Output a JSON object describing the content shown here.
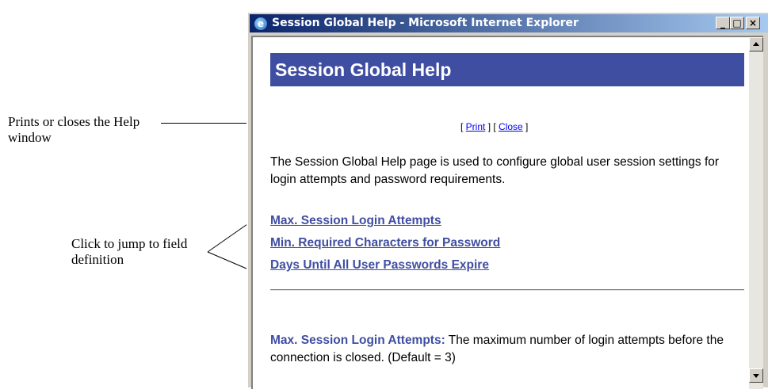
{
  "callouts": {
    "print_close": "Prints or closes the Help window",
    "field_jump": "Click to jump to field definition"
  },
  "window": {
    "title": "Session Global Help - Microsoft Internet Explorer",
    "icon": "ie-icon",
    "controls": {
      "minimize": "_",
      "maximize": "□",
      "close": "×"
    }
  },
  "page": {
    "heading": "Session Global Help",
    "toolbar": {
      "open1": "[ ",
      "print": "Print",
      "mid": " ] [ ",
      "close": "Close",
      "end": " ]"
    },
    "intro": "The Session Global Help page is used to configure global user session settings for login attempts and password requirements.",
    "field_links": [
      "Max. Session Login Attempts",
      "Min. Required Characters for Password",
      "Days Until All User Passwords Expire"
    ],
    "definition": {
      "term": "Max. Session Login Attempts:",
      "text": "  The maximum number of login attempts before the connection is closed. (Default = 3)"
    }
  },
  "colors": {
    "heading_bg": "#3f4ea1",
    "link": "#3f4ea1",
    "titlebar": "#0a246a"
  }
}
